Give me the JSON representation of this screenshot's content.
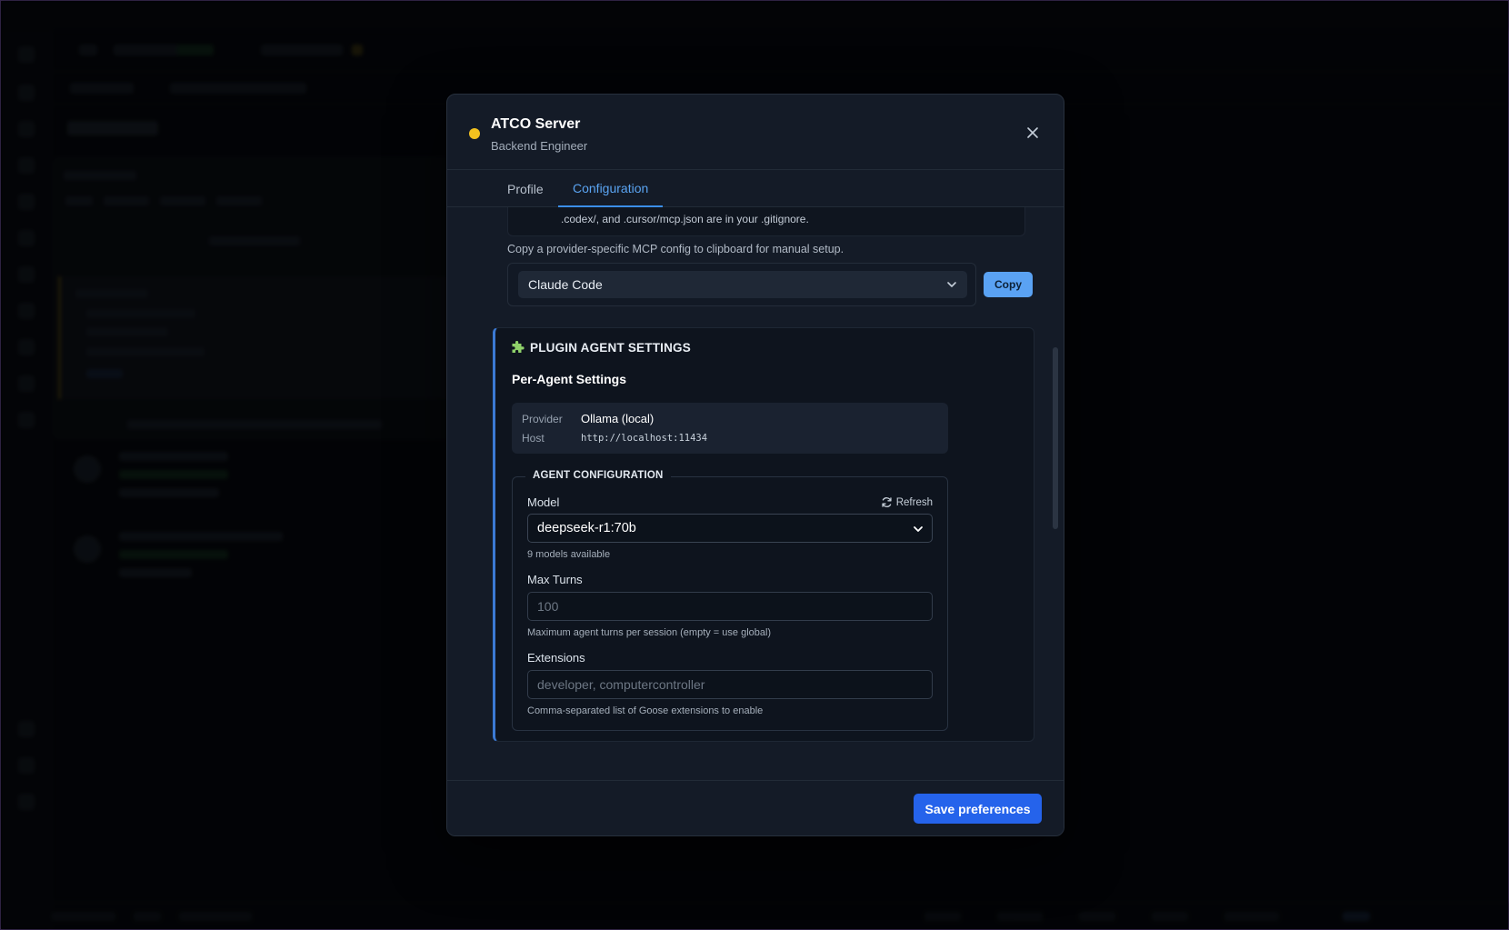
{
  "modal": {
    "title": "ATCO Server",
    "subtitle": "Backend Engineer",
    "status_color": "#f2c11f",
    "close_icon": "close-icon"
  },
  "tabs": [
    {
      "label": "Profile",
      "active": false
    },
    {
      "label": "Configuration",
      "active": true
    }
  ],
  "mcp": {
    "gitignore_note": ".codex/, and .cursor/mcp.json are in your .gitignore.",
    "copy_hint": "Copy a provider-specific MCP config to clipboard for manual setup.",
    "provider_selected": "Claude Code",
    "copy_label": "Copy"
  },
  "plugin": {
    "section_title": "PLUGIN AGENT SETTINGS",
    "section_icon": "puzzle-piece-icon",
    "per_agent_title": "Per-Agent Settings",
    "provider_label": "Provider",
    "provider_value": "Ollama (local)",
    "host_label": "Host",
    "host_value": "http://localhost:11434",
    "agent_config": {
      "legend": "AGENT CONFIGURATION",
      "model_label": "Model",
      "refresh_label": "Refresh",
      "model_value": "deepseek-r1:70b",
      "models_available": "9 models available",
      "max_turns_label": "Max Turns",
      "max_turns_placeholder": "100",
      "max_turns_help": "Maximum agent turns per session (empty = use global)",
      "extensions_label": "Extensions",
      "extensions_placeholder": "developer, computercontroller",
      "extensions_help": "Comma-separated list of Goose extensions to enable"
    }
  },
  "footer": {
    "save_label": "Save preferences",
    "accent": "#2563eb"
  }
}
